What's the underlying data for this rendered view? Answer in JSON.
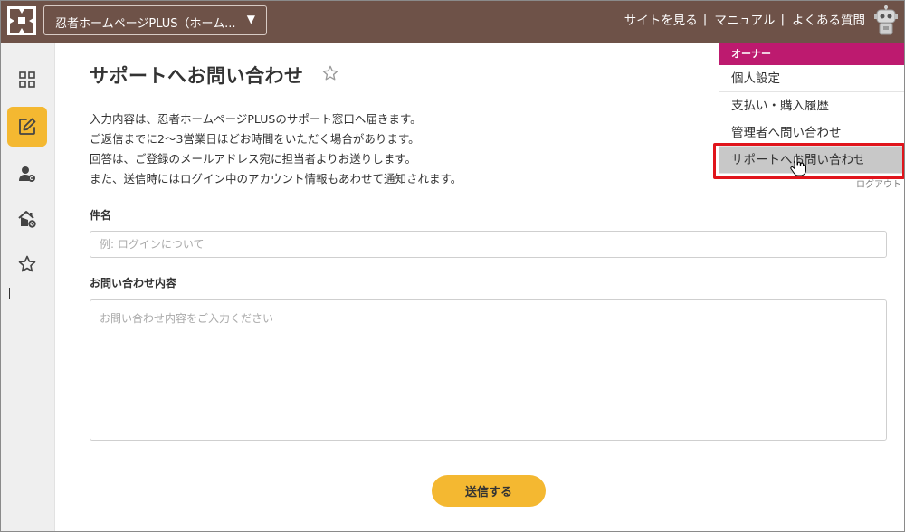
{
  "header": {
    "site_select_label": "忍者ホームページPLUS（ホーム...",
    "caret": "▼",
    "links": [
      "サイトを見る",
      "マニュアル",
      "よくある質問"
    ],
    "separator": "|",
    "bg_color": "#6e5248"
  },
  "sidebar": {
    "items": [
      {
        "icon": "dashboard-grid-icon"
      },
      {
        "icon": "edit-note-icon",
        "active": true
      },
      {
        "icon": "user-settings-icon"
      },
      {
        "icon": "home-settings-icon"
      },
      {
        "icon": "star-outline-icon"
      }
    ],
    "active_color": "#f4b831"
  },
  "main": {
    "title": "サポートへお問い合わせ",
    "description": [
      "入力内容は、忍者ホームページPLUSのサポート窓口へ届きます。",
      "ご返信までに2～3営業日ほどお時間をいただく場合があります。",
      "回答は、ご登録のメールアドレス宛に担当者よりお送りします。",
      "また、送信時にはログイン中のアカウント情報もあわせて通知されます。"
    ],
    "subject_label": "件名",
    "subject_placeholder": "例: ログインについて",
    "body_label": "お問い合わせ内容",
    "body_placeholder": "お問い合わせ内容をご入力ください",
    "submit_label": "送信する",
    "submit_color": "#f4b831"
  },
  "menu": {
    "header": "オーナー",
    "items": [
      "個人設定",
      "支払い・購入履歴",
      "管理者へ問い合わせ",
      "サポートへお問い合わせ"
    ],
    "hovered_index": 3,
    "logout": "ログアウト",
    "header_color": "#bd1a6f",
    "highlight_color": "#e0141b"
  }
}
